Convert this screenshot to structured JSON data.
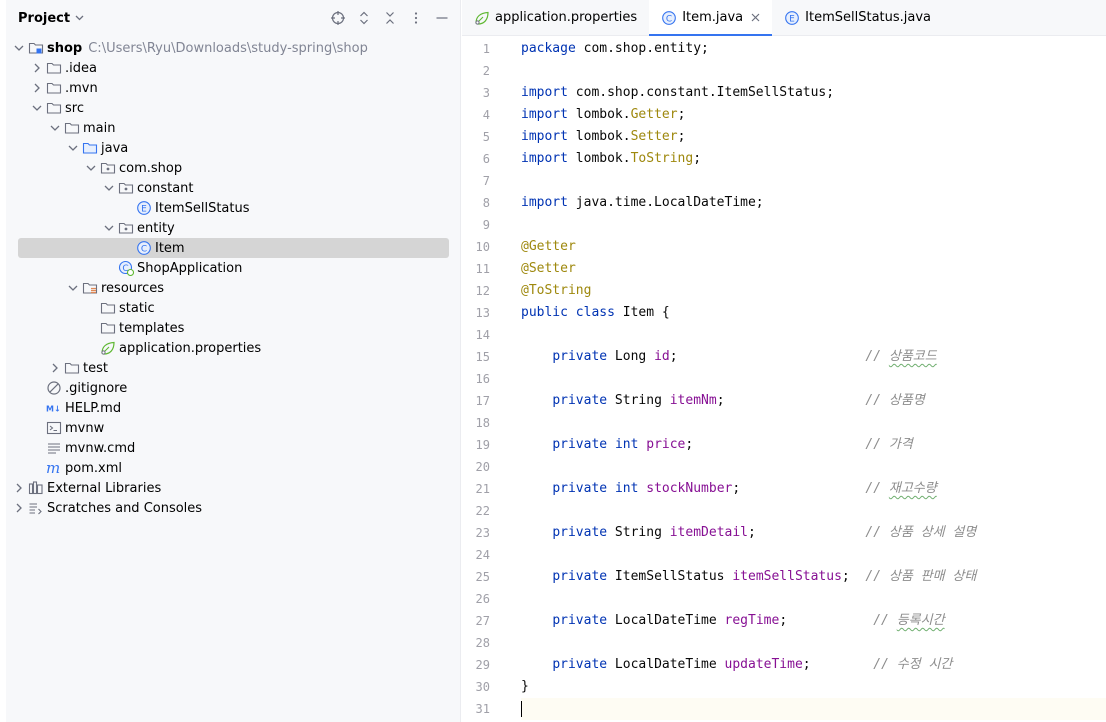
{
  "project": {
    "title": "Project",
    "tree": [
      {
        "depth": 0,
        "arrow": "down",
        "icon": "module-folder-icon",
        "label": "shop",
        "bold": true,
        "path": "C:\\Users\\Ryu\\Downloads\\study-spring\\shop"
      },
      {
        "depth": 1,
        "arrow": "right",
        "icon": "folder-icon",
        "label": ".idea"
      },
      {
        "depth": 1,
        "arrow": "right",
        "icon": "folder-icon",
        "label": ".mvn"
      },
      {
        "depth": 1,
        "arrow": "down",
        "icon": "folder-icon",
        "label": "src"
      },
      {
        "depth": 2,
        "arrow": "down",
        "icon": "folder-icon",
        "label": "main"
      },
      {
        "depth": 3,
        "arrow": "down",
        "icon": "source-folder-icon",
        "label": "java"
      },
      {
        "depth": 4,
        "arrow": "down",
        "icon": "package-icon",
        "label": "com.shop"
      },
      {
        "depth": 5,
        "arrow": "down",
        "icon": "package-icon",
        "label": "constant"
      },
      {
        "depth": 6,
        "arrow": "none",
        "icon": "enum-icon",
        "label": "ItemSellStatus"
      },
      {
        "depth": 5,
        "arrow": "down",
        "icon": "package-icon",
        "label": "entity"
      },
      {
        "depth": 6,
        "arrow": "none",
        "icon": "class-icon",
        "label": "Item",
        "selected": true
      },
      {
        "depth": 5,
        "arrow": "none",
        "icon": "spring-class-icon",
        "label": "ShopApplication"
      },
      {
        "depth": 3,
        "arrow": "down",
        "icon": "resources-folder-icon",
        "label": "resources"
      },
      {
        "depth": 4,
        "arrow": "none",
        "icon": "folder-icon",
        "label": "static"
      },
      {
        "depth": 4,
        "arrow": "none",
        "icon": "folder-icon",
        "label": "templates"
      },
      {
        "depth": 4,
        "arrow": "none",
        "icon": "spring-properties-icon",
        "label": "application.properties"
      },
      {
        "depth": 2,
        "arrow": "right",
        "icon": "folder-icon",
        "label": "test"
      },
      {
        "depth": 1,
        "arrow": "none",
        "icon": "ignore-file-icon",
        "label": ".gitignore"
      },
      {
        "depth": 1,
        "arrow": "none",
        "icon": "markdown-icon",
        "label": "HELP.md"
      },
      {
        "depth": 1,
        "arrow": "none",
        "icon": "terminal-icon",
        "label": "mvnw"
      },
      {
        "depth": 1,
        "arrow": "none",
        "icon": "text-file-icon",
        "label": "mvnw.cmd"
      },
      {
        "depth": 1,
        "arrow": "none",
        "icon": "maven-icon",
        "label": "pom.xml"
      },
      {
        "depth": 0,
        "arrow": "right",
        "icon": "libraries-icon",
        "label": "External Libraries"
      },
      {
        "depth": 0,
        "arrow": "right",
        "icon": "scratches-icon",
        "label": "Scratches and Consoles"
      }
    ]
  },
  "tabs": [
    {
      "label": "application.properties",
      "icon": "spring-properties-icon",
      "active": false
    },
    {
      "label": "Item.java",
      "icon": "class-icon",
      "active": true,
      "closable": true
    },
    {
      "label": "ItemSellStatus.java",
      "icon": "enum-icon",
      "active": false
    }
  ],
  "code": {
    "current_line": 31,
    "lines": [
      [
        {
          "t": "package",
          "c": "kw"
        },
        {
          "t": " com.shop.entity;"
        }
      ],
      [],
      [
        {
          "t": "import",
          "c": "kw"
        },
        {
          "t": " com.shop.constant.ItemSellStatus;"
        }
      ],
      [
        {
          "t": "import",
          "c": "kw"
        },
        {
          "t": " lombok."
        },
        {
          "t": "Getter",
          "c": "ann"
        },
        {
          "t": ";"
        }
      ],
      [
        {
          "t": "import",
          "c": "kw"
        },
        {
          "t": " lombok."
        },
        {
          "t": "Setter",
          "c": "ann"
        },
        {
          "t": ";"
        }
      ],
      [
        {
          "t": "import",
          "c": "kw"
        },
        {
          "t": " lombok."
        },
        {
          "t": "ToString",
          "c": "ann"
        },
        {
          "t": ";"
        }
      ],
      [],
      [
        {
          "t": "import",
          "c": "kw"
        },
        {
          "t": " java.time.LocalDateTime;"
        }
      ],
      [],
      [
        {
          "t": "@Getter",
          "c": "ann"
        }
      ],
      [
        {
          "t": "@Setter",
          "c": "ann"
        }
      ],
      [
        {
          "t": "@ToString",
          "c": "ann"
        }
      ],
      [
        {
          "t": "public",
          "c": "kw"
        },
        {
          "t": " "
        },
        {
          "t": "class",
          "c": "kw"
        },
        {
          "t": " Item {"
        }
      ],
      [],
      [
        {
          "t": "    "
        },
        {
          "t": "private",
          "c": "kw"
        },
        {
          "t": " Long "
        },
        {
          "t": "id",
          "c": "fld"
        },
        {
          "t": ";                        "
        },
        {
          "t": "// ",
          "c": "cmt"
        },
        {
          "t": "상품코드",
          "c": "cmt kr"
        }
      ],
      [],
      [
        {
          "t": "    "
        },
        {
          "t": "private",
          "c": "kw"
        },
        {
          "t": " String "
        },
        {
          "t": "itemNm",
          "c": "fld"
        },
        {
          "t": ";                  "
        },
        {
          "t": "// 상품명",
          "c": "cmt"
        }
      ],
      [],
      [
        {
          "t": "    "
        },
        {
          "t": "private",
          "c": "kw"
        },
        {
          "t": " "
        },
        {
          "t": "int",
          "c": "kw"
        },
        {
          "t": " "
        },
        {
          "t": "price",
          "c": "fld"
        },
        {
          "t": ";                      "
        },
        {
          "t": "// 가격",
          "c": "cmt"
        }
      ],
      [],
      [
        {
          "t": "    "
        },
        {
          "t": "private",
          "c": "kw"
        },
        {
          "t": " "
        },
        {
          "t": "int",
          "c": "kw"
        },
        {
          "t": " "
        },
        {
          "t": "stockNumber",
          "c": "fld"
        },
        {
          "t": ";                "
        },
        {
          "t": "// ",
          "c": "cmt"
        },
        {
          "t": "재고수량",
          "c": "cmt kr"
        }
      ],
      [],
      [
        {
          "t": "    "
        },
        {
          "t": "private",
          "c": "kw"
        },
        {
          "t": " String "
        },
        {
          "t": "itemDetail",
          "c": "fld"
        },
        {
          "t": ";              "
        },
        {
          "t": "// 상품 상세 설명",
          "c": "cmt"
        }
      ],
      [],
      [
        {
          "t": "    "
        },
        {
          "t": "private",
          "c": "kw"
        },
        {
          "t": " ItemSellStatus "
        },
        {
          "t": "itemSellStatus",
          "c": "fld"
        },
        {
          "t": ";  "
        },
        {
          "t": "// 상품 판매 상태",
          "c": "cmt"
        }
      ],
      [],
      [
        {
          "t": "    "
        },
        {
          "t": "private",
          "c": "kw"
        },
        {
          "t": " LocalDateTime "
        },
        {
          "t": "regTime",
          "c": "fld"
        },
        {
          "t": ";           "
        },
        {
          "t": "// ",
          "c": "cmt"
        },
        {
          "t": "등록시간",
          "c": "cmt kr"
        }
      ],
      [],
      [
        {
          "t": "    "
        },
        {
          "t": "private",
          "c": "kw"
        },
        {
          "t": " LocalDateTime "
        },
        {
          "t": "updateTime",
          "c": "fld"
        },
        {
          "t": ";        "
        },
        {
          "t": "// 수정 시간",
          "c": "cmt"
        }
      ],
      [
        {
          "t": "}"
        }
      ],
      []
    ]
  }
}
